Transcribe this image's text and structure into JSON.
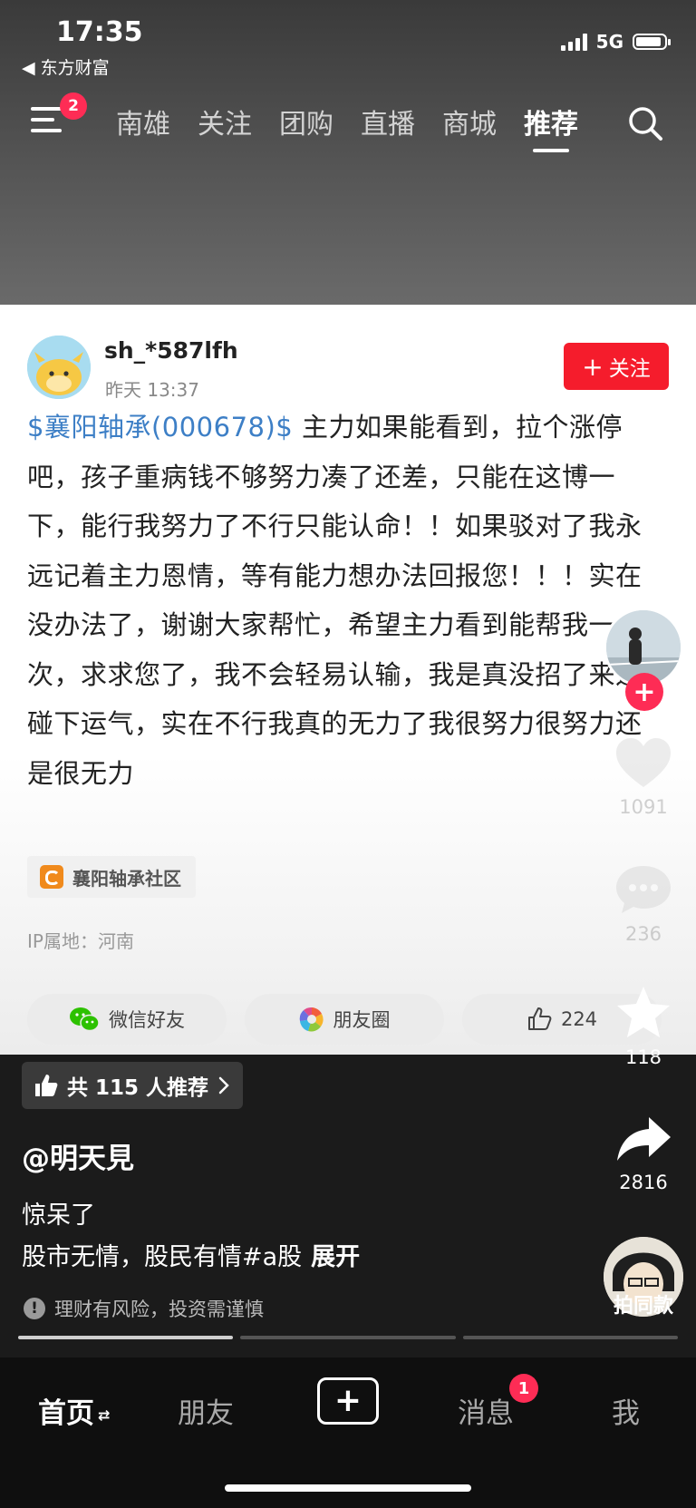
{
  "status_bar": {
    "time": "17:35",
    "back_app": "◀ 东方财富",
    "network": "5G",
    "battery_level_percent": 90
  },
  "header": {
    "menu_badge": "2",
    "tabs": [
      {
        "label": "南雄"
      },
      {
        "label": "关注"
      },
      {
        "label": "团购"
      },
      {
        "label": "直播"
      },
      {
        "label": "商城"
      },
      {
        "label": "推荐",
        "active": true
      }
    ]
  },
  "post": {
    "username": "sh_*587lfh",
    "time": "昨天 13:37",
    "follow_label": "关注",
    "stock_tag": "$襄阳轴承(000678)$",
    "body": " 主力如果能看到，拉个涨停吧，孩子重病钱不够努力凑了还差，只能在这博一下，能行我努力了不行只能认命！！如果驳对了我永远记着主力恩情，等有能力想办法回报您！！！实在没办法了，谢谢大家帮忙，希望主力看到能帮我一次，求求您了，我不会轻易认输，我是真没招了来这碰下运气，实在不行我真的无力了我很努力很努力还是很无力",
    "community": "襄阳轴承社区",
    "ip_location": "IP属地：河南",
    "share": {
      "wechat_label": "微信好友",
      "moments_label": "朋友圈",
      "like_count": "224"
    }
  },
  "video_info": {
    "recommend_label": "共 115 人推荐",
    "author": "@明天見",
    "caption_line1": "惊呆了",
    "caption_line2": "股市无情，股民有情#a股",
    "expand_label": "展开",
    "risk_notice": "理财有风险，投资需谨慎",
    "progress_active_segment": 1,
    "progress_segments": 3
  },
  "side_actions": {
    "likes": "1091",
    "comments": "236",
    "favorites": "118",
    "shares": "2816",
    "same_style_label": "拍同款"
  },
  "bottom_nav": {
    "home": "首页",
    "friends": "朋友",
    "messages": "消息",
    "messages_badge": "1",
    "me": "我"
  },
  "colors": {
    "accent_red": "#fe2c55",
    "follow_red": "#f51c2c",
    "link_blue": "#3d7fc6"
  }
}
